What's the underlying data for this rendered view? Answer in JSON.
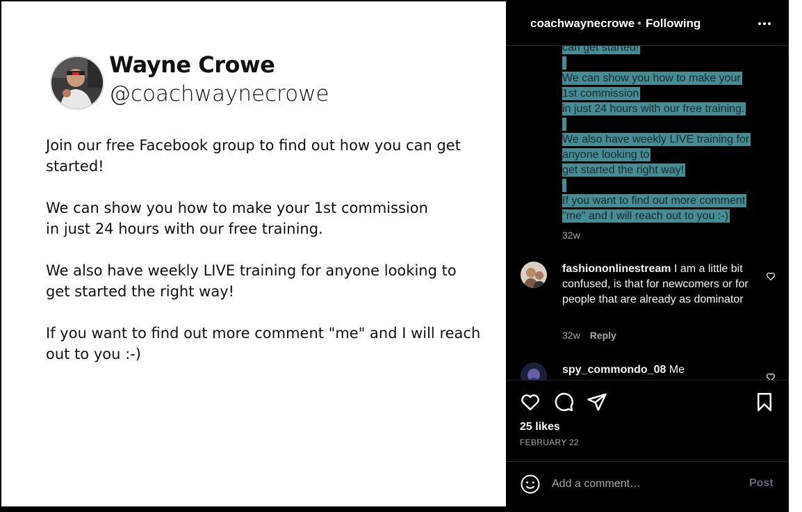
{
  "post": {
    "author_name": "Wayne Crowe",
    "author_handle": "@coachwaynecrowe",
    "paragraphs": [
      "Join our free Facebook group to find out  how you can get\nstarted!",
      "We can show you how to make your 1st commission\nin just 24 hours with our free training.",
      "We also have weekly LIVE training for anyone looking to\nget started the right way!",
      "If you want to find out more comment \"me\" and I will reach\nout to you :-)"
    ]
  },
  "header": {
    "username": "coachwaynecrowe",
    "separator": "•",
    "following": "Following"
  },
  "caption": {
    "lines": [
      "can get started!",
      "",
      "We can show you how to make your",
      "1st commission",
      "in just 24 hours with our free training.",
      "",
      "We also have weekly LIVE training for",
      "anyone looking to",
      "get started the right way!",
      "",
      "If you want to find out more comment",
      "\"me\" and I will reach out to you :-)"
    ],
    "time": "32w"
  },
  "comments": [
    {
      "user": "fashiononlinestream",
      "text": "I am a little bit confused, is that for newcomers or for people that are already as dominator",
      "time": "32w",
      "reply": "Reply"
    },
    {
      "user": "spy_commondo_08",
      "text": "Me"
    }
  ],
  "actions": {
    "likes": "25 likes",
    "date": "FEBRUARY 22"
  },
  "comment_bar": {
    "placeholder": "Add a comment…",
    "post_label": "Post"
  },
  "colors": {
    "highlight": "#468c94",
    "panel_bg": "#000000",
    "post_button": "#5a6a7e"
  }
}
